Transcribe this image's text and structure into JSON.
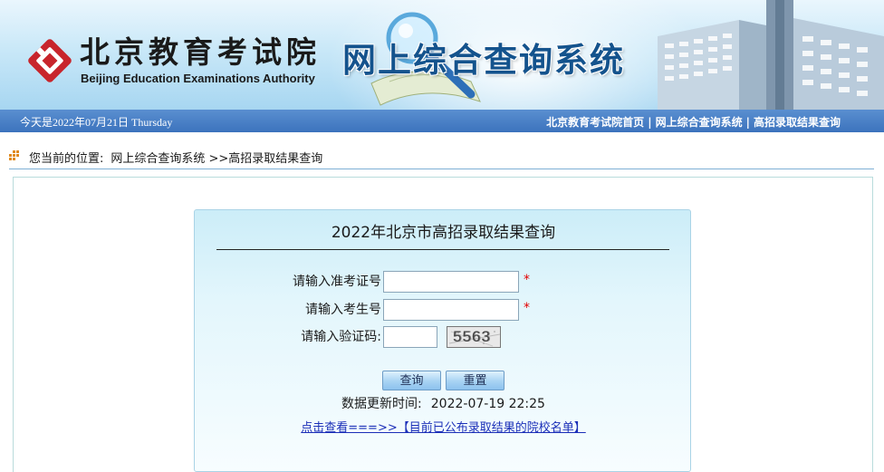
{
  "banner": {
    "org_name_cn": "北京教育考试院",
    "org_name_en": "Beijing Education Examinations Authority",
    "system_title": "网上综合查询系统"
  },
  "navbar": {
    "date_text": "今天是2022年07月21日 Thursday",
    "links": [
      {
        "label": "北京教育考试院首页"
      },
      {
        "label": "网上综合查询系统"
      },
      {
        "label": "高招录取结果查询"
      }
    ],
    "separator": "|"
  },
  "breadcrumb": {
    "prefix": "您当前的位置:",
    "path": "网上综合查询系统 >>高招录取结果查询"
  },
  "query": {
    "title": "2022年北京市高招录取结果查询",
    "fields": [
      {
        "label": "请输入准考证号",
        "value": "",
        "required_mark": "*"
      },
      {
        "label": "请输入考生号",
        "value": "",
        "required_mark": "*"
      },
      {
        "label": "请输入验证码:",
        "value": ""
      }
    ],
    "captcha_text": "5563",
    "submit_label": "查询",
    "reset_label": "重置",
    "update_label": "数据更新时间:",
    "update_value": "2022-07-19 22:25",
    "list_link_text": "点击查看===>>【目前已公布录取结果的院校名单】"
  },
  "colors": {
    "title_blue": "#14538d",
    "nav_bar": "#3c73bd",
    "required": "#e30000",
    "link": "#1b2fb8"
  }
}
